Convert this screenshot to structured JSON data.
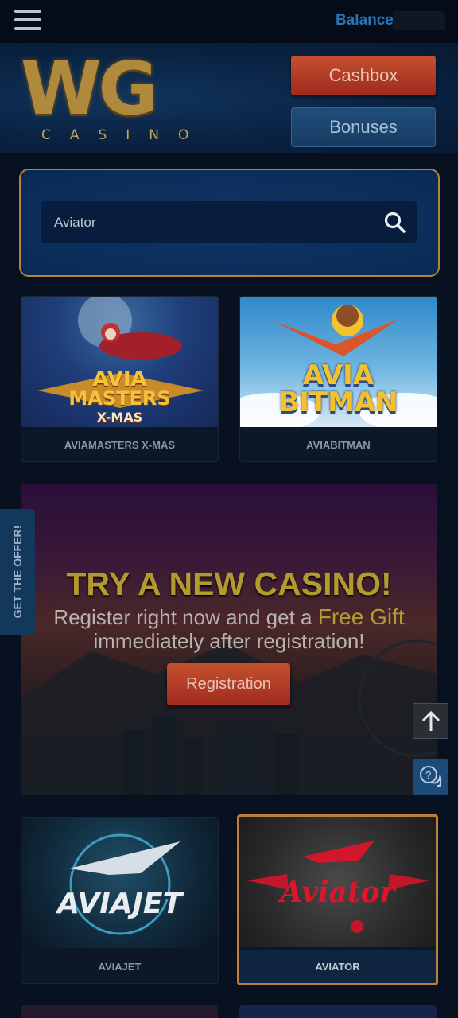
{
  "topbar": {
    "balance_label": "Balance"
  },
  "logo": {
    "main": "WG",
    "sub": "CASINO"
  },
  "header": {
    "cashbox_label": "Cashbox",
    "bonuses_label": "Bonuses"
  },
  "search": {
    "value": "Aviator",
    "placeholder": ""
  },
  "games": [
    {
      "title": "AVIAMASTERS X-MAS",
      "art_line1": "AVIA",
      "art_line2": "MASTERS",
      "art_line3": "X-MAS"
    },
    {
      "title": "AVIABITMAN",
      "art_line1": "AVIA",
      "art_line2": "BITMAN"
    },
    {
      "title": "AVIAJET",
      "art_line1": "AVIAJET"
    },
    {
      "title": "AVIATOR",
      "art_line1": "Aviator"
    }
  ],
  "promo": {
    "title": "TRY A NEW CASINO!",
    "line1_prefix": "Register right now and get a",
    "line1_highlight": "Free Gift",
    "line2": "immediately after registration!",
    "button_label": "Registration"
  },
  "offer_tab": {
    "label": "GET THE OFFER!"
  },
  "colors": {
    "accent_gold": "#b8823a",
    "button_red": "#c4502e",
    "button_blue": "#1f4d7a",
    "balance_blue": "#2a74b8"
  },
  "icons": {
    "menu": "hamburger-icon",
    "search": "search-icon",
    "scroll_top": "arrow-up-icon",
    "chat": "chat-help-icon"
  }
}
